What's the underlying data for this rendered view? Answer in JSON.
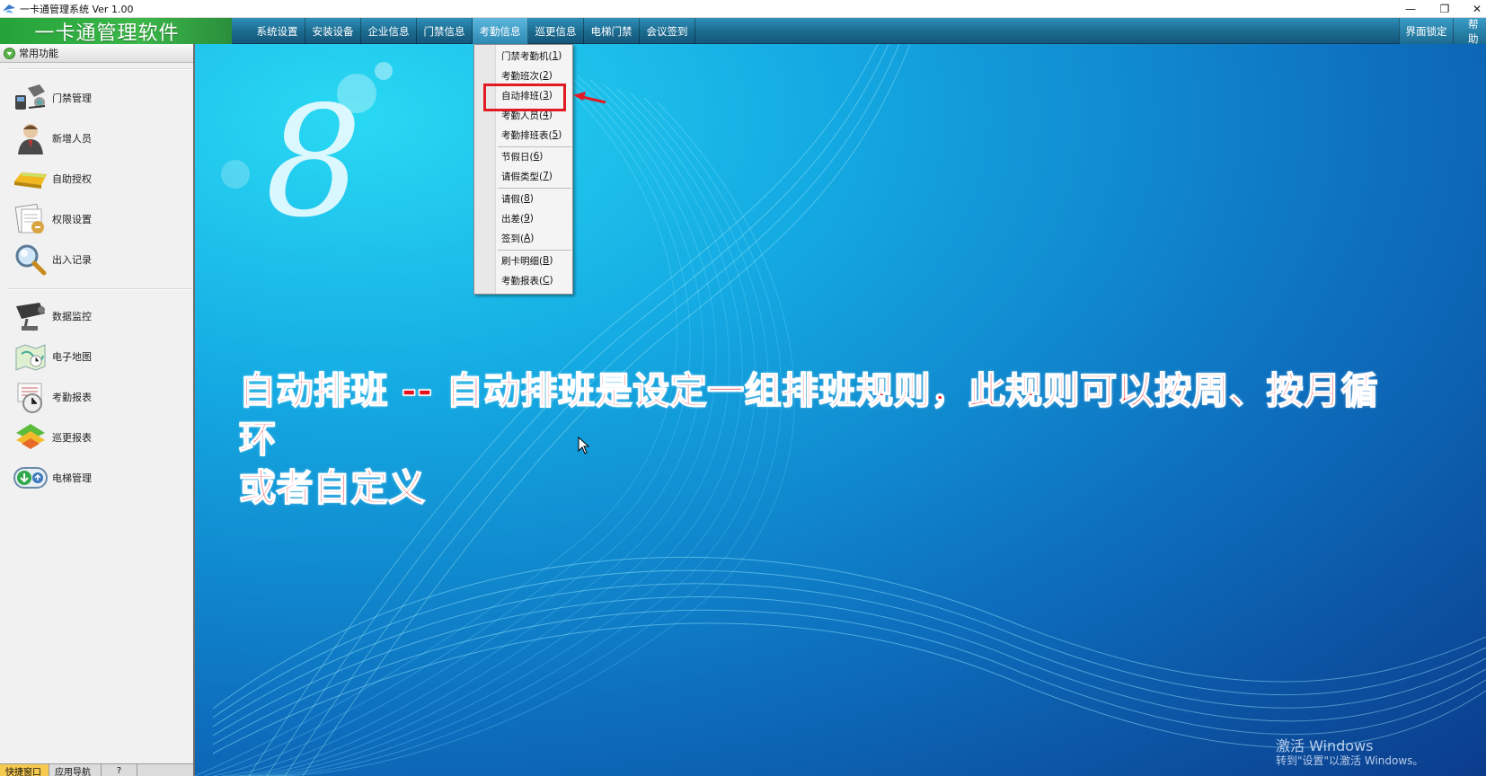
{
  "window": {
    "title": "一卡通管理系统  Ver 1.00",
    "controls": [
      "minimize-icon",
      "restore-icon",
      "close-icon"
    ]
  },
  "menubar": {
    "brand": "一卡通管理软件",
    "items": [
      {
        "label": "系统设置"
      },
      {
        "label": "安装设备"
      },
      {
        "label": "企业信息"
      },
      {
        "label": "门禁信息"
      },
      {
        "label": "考勤信息",
        "active": true
      },
      {
        "label": "巡更信息"
      },
      {
        "label": "电梯门禁"
      },
      {
        "label": "会议签到"
      }
    ],
    "right_items": [
      {
        "label": "界面锁定"
      },
      {
        "label": "帮助"
      }
    ]
  },
  "sidebar": {
    "header": "常用功能",
    "group1": [
      {
        "label": "门禁管理",
        "icon": "access-control-icon"
      },
      {
        "label": "新增人员",
        "icon": "user-add-icon"
      },
      {
        "label": "自助授权",
        "icon": "card-icon"
      },
      {
        "label": "权限设置",
        "icon": "permission-icon"
      },
      {
        "label": "出入记录",
        "icon": "magnifier-icon"
      }
    ],
    "group2": [
      {
        "label": "数据监控",
        "icon": "camera-icon"
      },
      {
        "label": "电子地图",
        "icon": "map-icon"
      },
      {
        "label": "考勤报表",
        "icon": "clock-icon"
      },
      {
        "label": "巡更报表",
        "icon": "patrol-icon"
      },
      {
        "label": "电梯管理",
        "icon": "elevator-icon"
      }
    ],
    "bottom_tabs": [
      {
        "label": "快捷窗口",
        "active": true
      },
      {
        "label": "应用导航"
      },
      {
        "label": "?"
      }
    ]
  },
  "dropdown": {
    "groups": [
      [
        {
          "label": "门禁考勤机(",
          "key": "1"
        },
        {
          "label": "考勤班次(",
          "key": "2"
        },
        {
          "label": "自动排班(",
          "key": "3",
          "highlighted": true
        },
        {
          "label": "考勤人员(",
          "key": "4"
        },
        {
          "label": "考勤排班表(",
          "key": "5"
        }
      ],
      [
        {
          "label": "节假日(",
          "key": "6"
        },
        {
          "label": "请假类型(",
          "key": "7"
        }
      ],
      [
        {
          "label": "请假(",
          "key": "8"
        },
        {
          "label": "出差(",
          "key": "9"
        },
        {
          "label": "签到(",
          "key": "A"
        }
      ],
      [
        {
          "label": "刷卡明细(",
          "key": "B"
        },
        {
          "label": "考勤报表(",
          "key": "C"
        }
      ]
    ]
  },
  "annotation": {
    "caption_line1": "自动排班 -- 自动排班是设定一组排班规则，此规则可以按周、按月循环",
    "caption_line2": "或者自定义",
    "box_color": "#e01b24"
  },
  "watermark": {
    "line1": "激活 Windows",
    "line2": "转到\"设置\"以激活 Windows。"
  },
  "colors": {
    "brand_green": "#3bb848",
    "menubar_blue": "#1b6a8f",
    "desktop_blue": "#0d6fbe",
    "caption_red": "#e8101b"
  }
}
